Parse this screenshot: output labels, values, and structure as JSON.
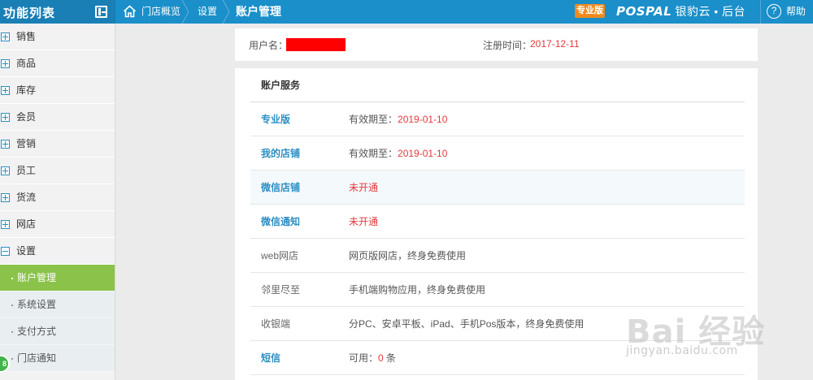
{
  "topbar": {
    "func_title": "功能列表",
    "breadcrumbs": [
      "门店概览",
      "设置",
      "账户管理"
    ],
    "pro_badge": "专业版",
    "brand_logo": "POSPAL",
    "brand_cn": "银豹云 • 后台",
    "help": "帮助",
    "help_icon": "?",
    "color_primary": "#1a8fc9",
    "color_badge": "#f08a1c"
  },
  "sidebar": {
    "items": [
      {
        "label": "销售"
      },
      {
        "label": "商品"
      },
      {
        "label": "库存"
      },
      {
        "label": "会员"
      },
      {
        "label": "营销"
      },
      {
        "label": "员工"
      },
      {
        "label": "货流"
      },
      {
        "label": "网店"
      },
      {
        "label": "设置"
      }
    ],
    "sub_items": [
      {
        "label": "账户管理"
      },
      {
        "label": "系统设置"
      },
      {
        "label": "支付方式"
      },
      {
        "label": "门店通知"
      }
    ],
    "chat_badge": "8",
    "active_color": "#8bc34a"
  },
  "user_card": {
    "username_label": "用户名：",
    "register_label": "注册时间：",
    "register_date": "2017-12-11"
  },
  "services": {
    "heading": "账户服务",
    "rows": [
      {
        "name": "专业版",
        "prefix": "有效期至：",
        "value": "2019-01-10",
        "suffix": ""
      },
      {
        "name": "我的店铺",
        "prefix": "有效期至：",
        "value": "2019-01-10",
        "suffix": ""
      },
      {
        "name": "微信店铺",
        "prefix": "",
        "value": "未开通",
        "suffix": ""
      },
      {
        "name": "微信通知",
        "prefix": "",
        "value": "未开通",
        "suffix": ""
      },
      {
        "name": "web网店",
        "prefix": "网页版网店，终身免费使用",
        "value": "",
        "suffix": ""
      },
      {
        "name": "邻里尽至",
        "prefix": "手机端购物应用，终身免费使用",
        "value": "",
        "suffix": ""
      },
      {
        "name": "收银端",
        "prefix": "分PC、安卓平板、iPad、手机Pos版本，终身免费使用",
        "value": "",
        "suffix": ""
      },
      {
        "name": "短信",
        "prefix": "可用：",
        "value": "0",
        "suffix": " 条"
      }
    ]
  },
  "watermark": {
    "logo": "Bai 经验",
    "url": "jingyan.baidu.com"
  }
}
